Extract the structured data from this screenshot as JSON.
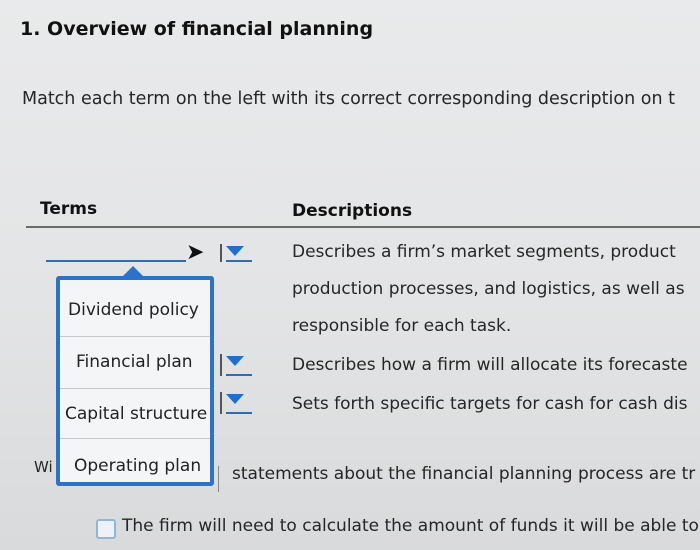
{
  "question": {
    "title": "1. Overview of financial planning",
    "instruction": "Match each term on the left with its correct corresponding description on t"
  },
  "table": {
    "terms_header": "Terms",
    "descriptions_header": "Descriptions",
    "descriptions": [
      "Describes a firm’s market segments, product",
      "production processes, and logistics, as well as",
      "responsible for each task.",
      "Describes how a firm will allocate its forecaste",
      "Sets forth specific targets for cash for cash dis"
    ]
  },
  "dropdown": {
    "options": [
      "Dividend policy",
      "Financial plan",
      "Capital structure",
      "Operating plan"
    ]
  },
  "next_question": {
    "prefix": "Wi",
    "text": "statements about the financial planning process are tr",
    "option_1": "The firm will need to calculate the amount of funds it will be able to"
  },
  "colors": {
    "accent": "#2a73c9",
    "caret": "#1f6fd1"
  }
}
